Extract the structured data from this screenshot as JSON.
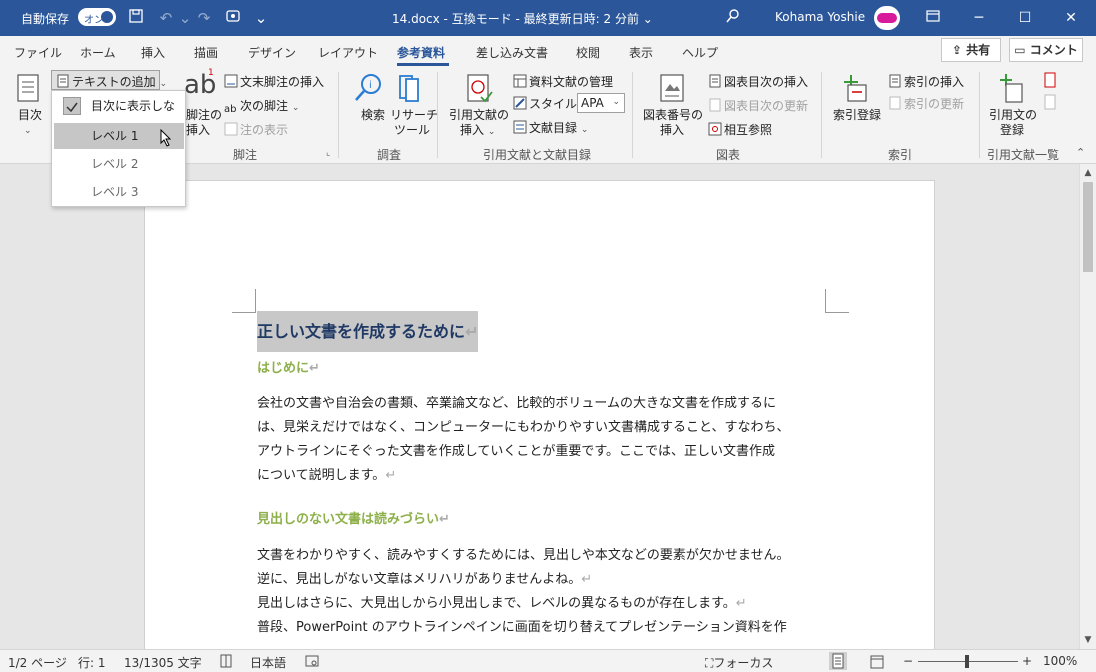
{
  "titlebar": {
    "autosave_label": "自動保存",
    "autosave_toggle": "オン",
    "title": "14.docx  -  互換モード  -  最終更新日時: 2 分前",
    "title_chevron": "⌄",
    "user_name": "Kohama Yoshie",
    "icons": [
      "save-icon",
      "undo-icon",
      "redo-icon",
      "touch-mode-icon",
      "customize-qat-icon",
      "search-icon",
      "ribbon-display-icon",
      "minimize-icon",
      "maximize-icon",
      "close-icon"
    ]
  },
  "tabs": [
    "ファイル",
    "ホーム",
    "挿入",
    "描画",
    "デザイン",
    "レイアウト",
    "参考資料",
    "差し込み文書",
    "校閲",
    "表示",
    "ヘルプ"
  ],
  "active_tab": "参考資料",
  "share_label": "共有",
  "comment_label": "コメント",
  "ribbon": {
    "toc": {
      "toc_label": "目次",
      "add_text_label": "テキストの追加",
      "footnote_insert_label_1": "脚注の",
      "footnote_insert_label_2": "挿入",
      "endnote_insert_label": "文末脚注の挿入",
      "next_footnote_label": "次の脚注",
      "show_notes_label": "注の表示",
      "footnote_group_label": "脚注"
    },
    "research": {
      "search_label": "検索",
      "researcher_label_1": "リサーチ",
      "researcher_label_2": "ツール",
      "group_label": "調査"
    },
    "citations": {
      "insert_citation_label_1": "引用文献の",
      "insert_citation_label_2": "挿入",
      "manage_sources_label": "資料文献の管理",
      "style_label": "スタイル:",
      "style_value": "APA",
      "bibliography_label": "文献目録",
      "group_label": "引用文献と文献目録"
    },
    "captions": {
      "insert_caption_label_1": "図表番号の",
      "insert_caption_label_2": "挿入",
      "insert_tof_label": "図表目次の挿入",
      "update_tof_label": "図表目次の更新",
      "cross_ref_label": "相互参照",
      "group_label": "図表"
    },
    "index": {
      "mark_entry_label": "索引登録",
      "insert_index_label": "索引の挿入",
      "update_index_label": "索引の更新",
      "group_label": "索引"
    },
    "toa": {
      "mark_citation_label_1": "引用文の",
      "mark_citation_label_2": "登録",
      "group_label": "引用文献一覧"
    }
  },
  "menu": {
    "items": [
      "目次に表示しない",
      "レベル 1",
      "レベル 2",
      "レベル 3"
    ]
  },
  "document": {
    "heading1": "正しい文書を作成するために",
    "sections": [
      {
        "heading": "はじめに",
        "lines": [
          "会社の文書や自治会の書類、卒業論文など、比較的ボリュームの大きな文書を作成するに",
          "は、見栄えだけではなく、コンピューターにもわかりやすい文書構成すること、すなわち、",
          "アウトラインにそぐった文書を作成していくことが重要です。ここでは、正しい文書作成",
          "について説明します。"
        ]
      },
      {
        "heading": "見出しのない文書は読みづらい",
        "lines": [
          "文書をわかりやすく、読みやすくするためには、見出しや本文などの要素が欠かせません。",
          "逆に、見出しがない文章はメリハリがありませんよね。",
          "見出しはさらに、大見出しから小見出しまで、レベルの異なるものが存在します。",
          "普段、PowerPoint のアウトラインペインに画面を切り替えてプレゼンテーション資料を作"
        ]
      }
    ],
    "pilcrow": "↵"
  },
  "statusbar": {
    "page": "1/2 ページ",
    "line": "行: 1",
    "words": "13/1305 文字",
    "language": "日本語",
    "focus": "フォーカス",
    "zoom_out": "−",
    "zoom_in": "+",
    "zoom": "100%"
  },
  "colors": {
    "title_bar": "#2b579a",
    "heading1": "#1f3864",
    "heading2": "#8db04a"
  }
}
